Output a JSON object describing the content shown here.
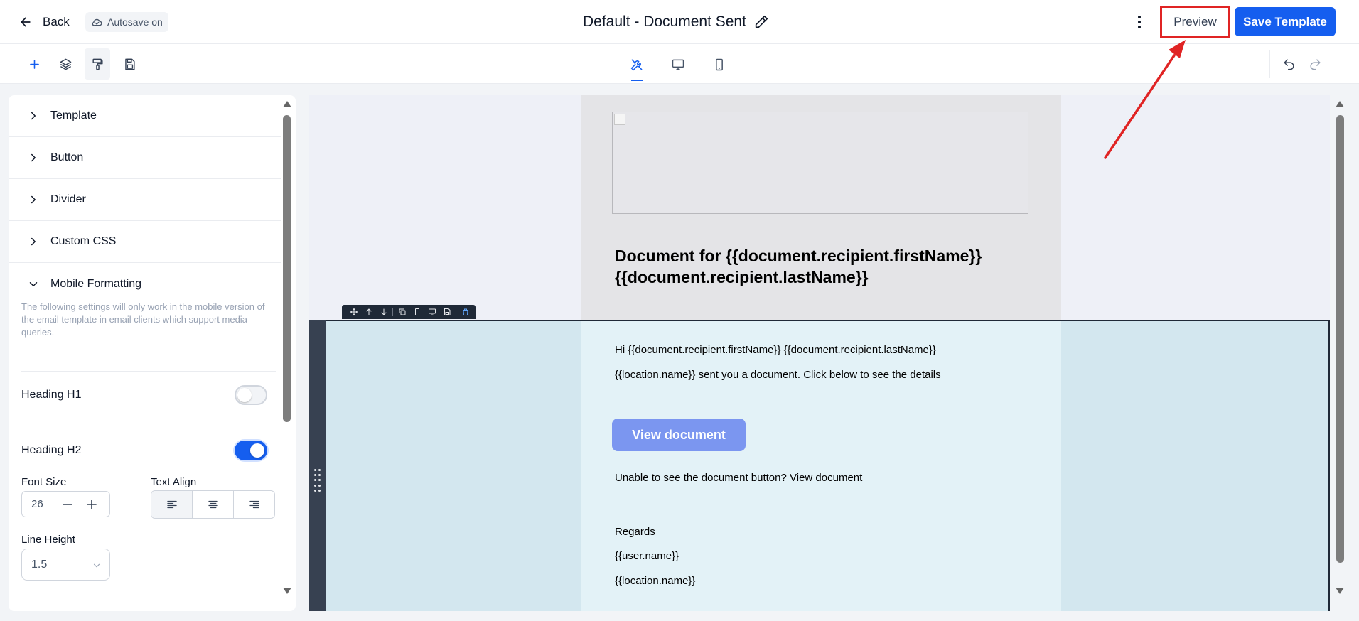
{
  "header": {
    "back_label": "Back",
    "autosave_label": "Autosave on",
    "title": "Default - Document Sent",
    "preview_label": "Preview",
    "save_label": "Save Template"
  },
  "toolbar": {
    "tools": [
      "add-icon",
      "layers-icon",
      "paint-roller-icon",
      "save-icon"
    ],
    "view_tabs": [
      "tools-icon",
      "desktop-icon",
      "mobile-icon"
    ],
    "undo": "undo-icon",
    "redo": "redo-icon"
  },
  "sidebar": {
    "sections": [
      {
        "label": "Template"
      },
      {
        "label": "Button"
      },
      {
        "label": "Divider"
      },
      {
        "label": "Custom CSS"
      },
      {
        "label": "Mobile Formatting"
      }
    ],
    "mobile_description": "The following settings will only work in the mobile version of the email template in email clients which support media queries.",
    "heading_h1": {
      "label": "Heading H1",
      "enabled": false
    },
    "heading_h2": {
      "label": "Heading H2",
      "enabled": true
    },
    "font_size": {
      "label": "Font Size",
      "value": "26"
    },
    "text_align": {
      "label": "Text Align",
      "selected": "left"
    },
    "line_height": {
      "label": "Line Height",
      "value": "1.5"
    }
  },
  "email": {
    "heading": "Document for {{document.recipient.firstName}} {{document.recipient.lastName}}",
    "greeting": "Hi {{document.recipient.firstName}} {{document.recipient.lastName}}",
    "sent_line": "{{location.name}} sent you a document. Click below to see the details",
    "button_label": "View document",
    "fallback_text": "Unable to see the document button?",
    "fallback_link": "View document",
    "regards": "Regards",
    "user_name": "{{user.name}}",
    "location_name": "{{location.name}}"
  },
  "colors": {
    "primary": "#155eef",
    "annotation": "#e02424",
    "email_button": "#7b96f0"
  }
}
